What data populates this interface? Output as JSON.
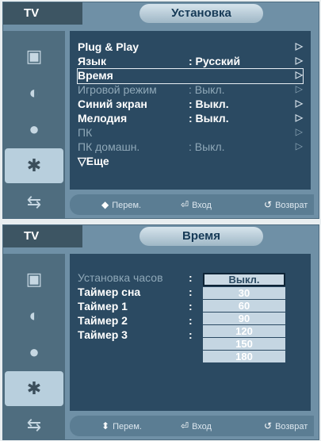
{
  "panel1": {
    "tv_label": "TV",
    "title": "Установка",
    "menu": [
      {
        "label": "Plug & Play",
        "value": "",
        "arrow": "▷",
        "state": "normal"
      },
      {
        "label": "Язык",
        "value": ": Русский",
        "arrow": "▷",
        "state": "normal"
      },
      {
        "label": "Время",
        "value": "",
        "arrow": "▷",
        "state": "selected"
      },
      {
        "label": "Игровой режим",
        "value": ": Выкл.",
        "arrow": "▷",
        "state": "dim"
      },
      {
        "label": "Синий экран",
        "value": ": Выкл.",
        "arrow": "▷",
        "state": "normal"
      },
      {
        "label": "Мелодия",
        "value": ": Выкл.",
        "arrow": "▷",
        "state": "normal"
      },
      {
        "label": "ПК",
        "value": "",
        "arrow": "▷",
        "state": "dim"
      },
      {
        "label": "ПК домашн.",
        "value": ": Выкл.",
        "arrow": "▷",
        "state": "dim"
      },
      {
        "label": "▽Еще",
        "value": "",
        "arrow": "",
        "state": "normal"
      }
    ],
    "footer": {
      "move": "Перем.",
      "enter": "Вход",
      "back": "Возврат"
    }
  },
  "panel2": {
    "tv_label": "TV",
    "title": "Время",
    "menu": [
      {
        "label": "Установка часов",
        "state": "dim"
      },
      {
        "label": "Таймер сна",
        "state": "normal"
      },
      {
        "label": "Таймер 1",
        "state": "normal"
      },
      {
        "label": "Таймер 2",
        "state": "normal"
      },
      {
        "label": "Таймер 3",
        "state": "normal"
      }
    ],
    "dropdown": [
      "Выкл.",
      "30",
      "60",
      "90",
      "120",
      "150",
      "180"
    ],
    "dropdown_selected": "Выкл.",
    "footer": {
      "move": "Перем.",
      "enter": "Вход",
      "back": "Возврат"
    }
  },
  "sidebar_icons": [
    "picture-icon",
    "sound-icon",
    "channel-icon",
    "setup-icon",
    "input-icon"
  ],
  "colors": {
    "panel": "#6f90a6",
    "content": "#2b4a62",
    "sidebar": "#4f6d7f",
    "accent": "#b8cfdd"
  }
}
